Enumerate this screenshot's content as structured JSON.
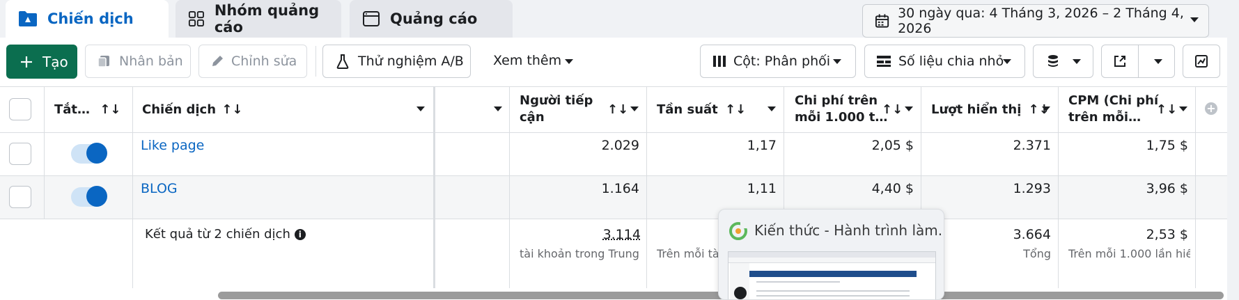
{
  "tabs": [
    {
      "label": "Chiến dịch",
      "icon": "folder-icon",
      "active": true
    },
    {
      "label": "Nhóm quảng cáo",
      "icon": "grid-icon",
      "active": false
    },
    {
      "label": "Quảng cáo",
      "icon": "window-icon",
      "active": false
    }
  ],
  "date_range": {
    "label": "30 ngày qua: 4 Tháng 3, 2026 – 2 Tháng 4, 2026"
  },
  "toolbar": {
    "create": "Tạo",
    "duplicate": "Nhân bản",
    "edit": "Chỉnh sửa",
    "ab_test": "Thử nghiệm A/B",
    "more": "Xem thêm",
    "columns": "Cột: Phân phối",
    "breakdown": "Số liệu chia nhỏ"
  },
  "table": {
    "headers": {
      "toggle": "Tắt…",
      "campaign": "Chiến dịch",
      "reach_line1": "Người tiếp",
      "reach_line2": "cận",
      "frequency": "Tần suất",
      "cpm1000_line1": "Chi phí trên",
      "cpm1000_line2": "mỗi 1.000 t…",
      "impressions": "Lượt hiển thị",
      "cpm_line1": "CPM (Chi phí",
      "cpm_line2": "trên mỗi…"
    },
    "rows": [
      {
        "name": "Like page",
        "reach": "2.029",
        "frequency": "1,17",
        "cost_per_1000": "2,05 $",
        "impressions": "2.371",
        "cpm": "1,75 $"
      },
      {
        "name": "BLOG",
        "reach": "1.164",
        "frequency": "1,11",
        "cost_per_1000": "4,40 $",
        "impressions": "1.293",
        "cpm": "3,96 $"
      }
    ],
    "summary": {
      "label": "Kết quả từ 2 chiến dịch",
      "reach": "3.114",
      "reach_sub": "tài khoản trong Trung …",
      "frequency_sub": "Trên mỗi tài",
      "impressions": "3.664",
      "impressions_sub": "Tổng",
      "cpm": "2,53 $",
      "cpm_sub": "Trên mỗi 1.000 lần hiể…"
    }
  },
  "popup": {
    "title": "Kiến thức - Hành trình làm..."
  },
  "colors": {
    "accent": "#0a66c2",
    "create_green": "#0b6e4f"
  }
}
